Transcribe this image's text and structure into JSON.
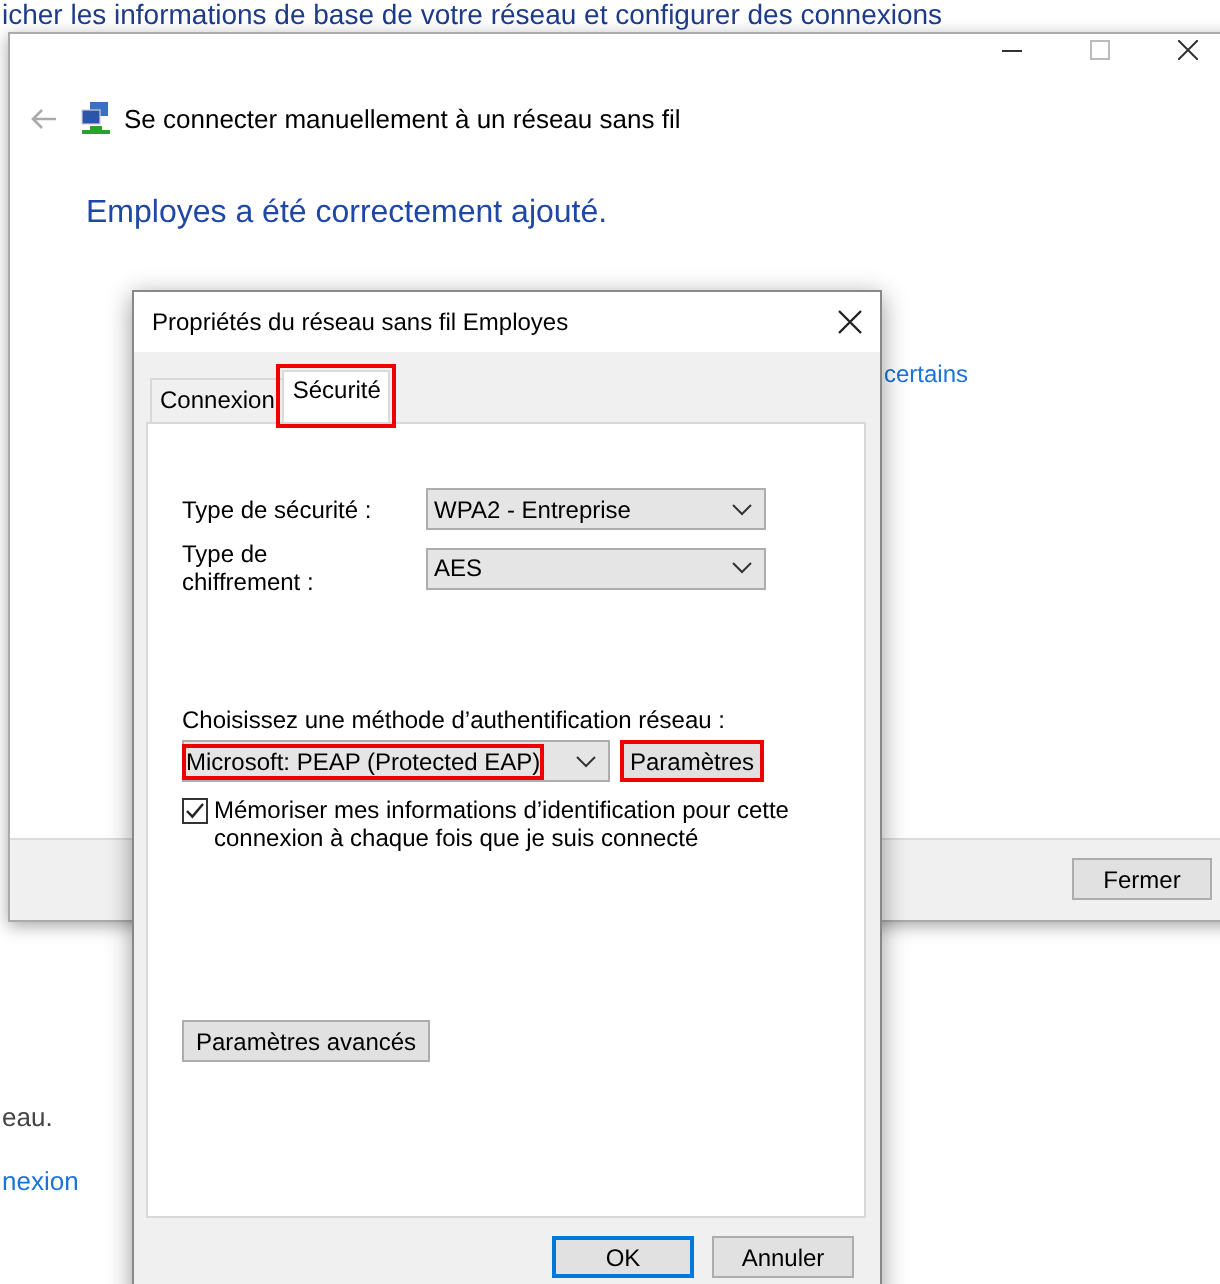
{
  "background": {
    "heading": "icher les informations de base de votre réseau et configurer des connexions",
    "text_fragment": "eau.",
    "link_fragment": "nexion"
  },
  "wizard": {
    "title": "Se connecter manuellement à un réseau sans fil",
    "message": "Employes a été correctement ajouté.",
    "link_fragment": "certains",
    "buttons": [
      "Fermer"
    ]
  },
  "dialog": {
    "title": "Propriétés du réseau sans fil Employes",
    "tabs": [
      {
        "label": "Connexion",
        "selected": false,
        "highlighted": false
      },
      {
        "label": "Sécurité",
        "selected": true,
        "highlighted": true
      }
    ],
    "fields": [
      {
        "label": "Type de sécurité :",
        "value": "WPA2 - Entreprise"
      },
      {
        "label": "Type de chiffrement :",
        "value": "AES"
      }
    ],
    "auth": {
      "label": "Choisissez une méthode d’authentification réseau :",
      "value": "Microsoft: PEAP (Protected EAP)",
      "highlighted": true,
      "button": {
        "label": "Paramètres",
        "highlighted": true
      }
    },
    "remember": {
      "label": "Mémoriser mes informations d’identification pour cette connexion à chaque fois que je suis connecté",
      "checked": true
    },
    "advanced_button": "Paramètres avancés",
    "buttons": [
      {
        "label": "OK",
        "default": true
      },
      {
        "label": "Annuler",
        "default": false
      }
    ]
  }
}
